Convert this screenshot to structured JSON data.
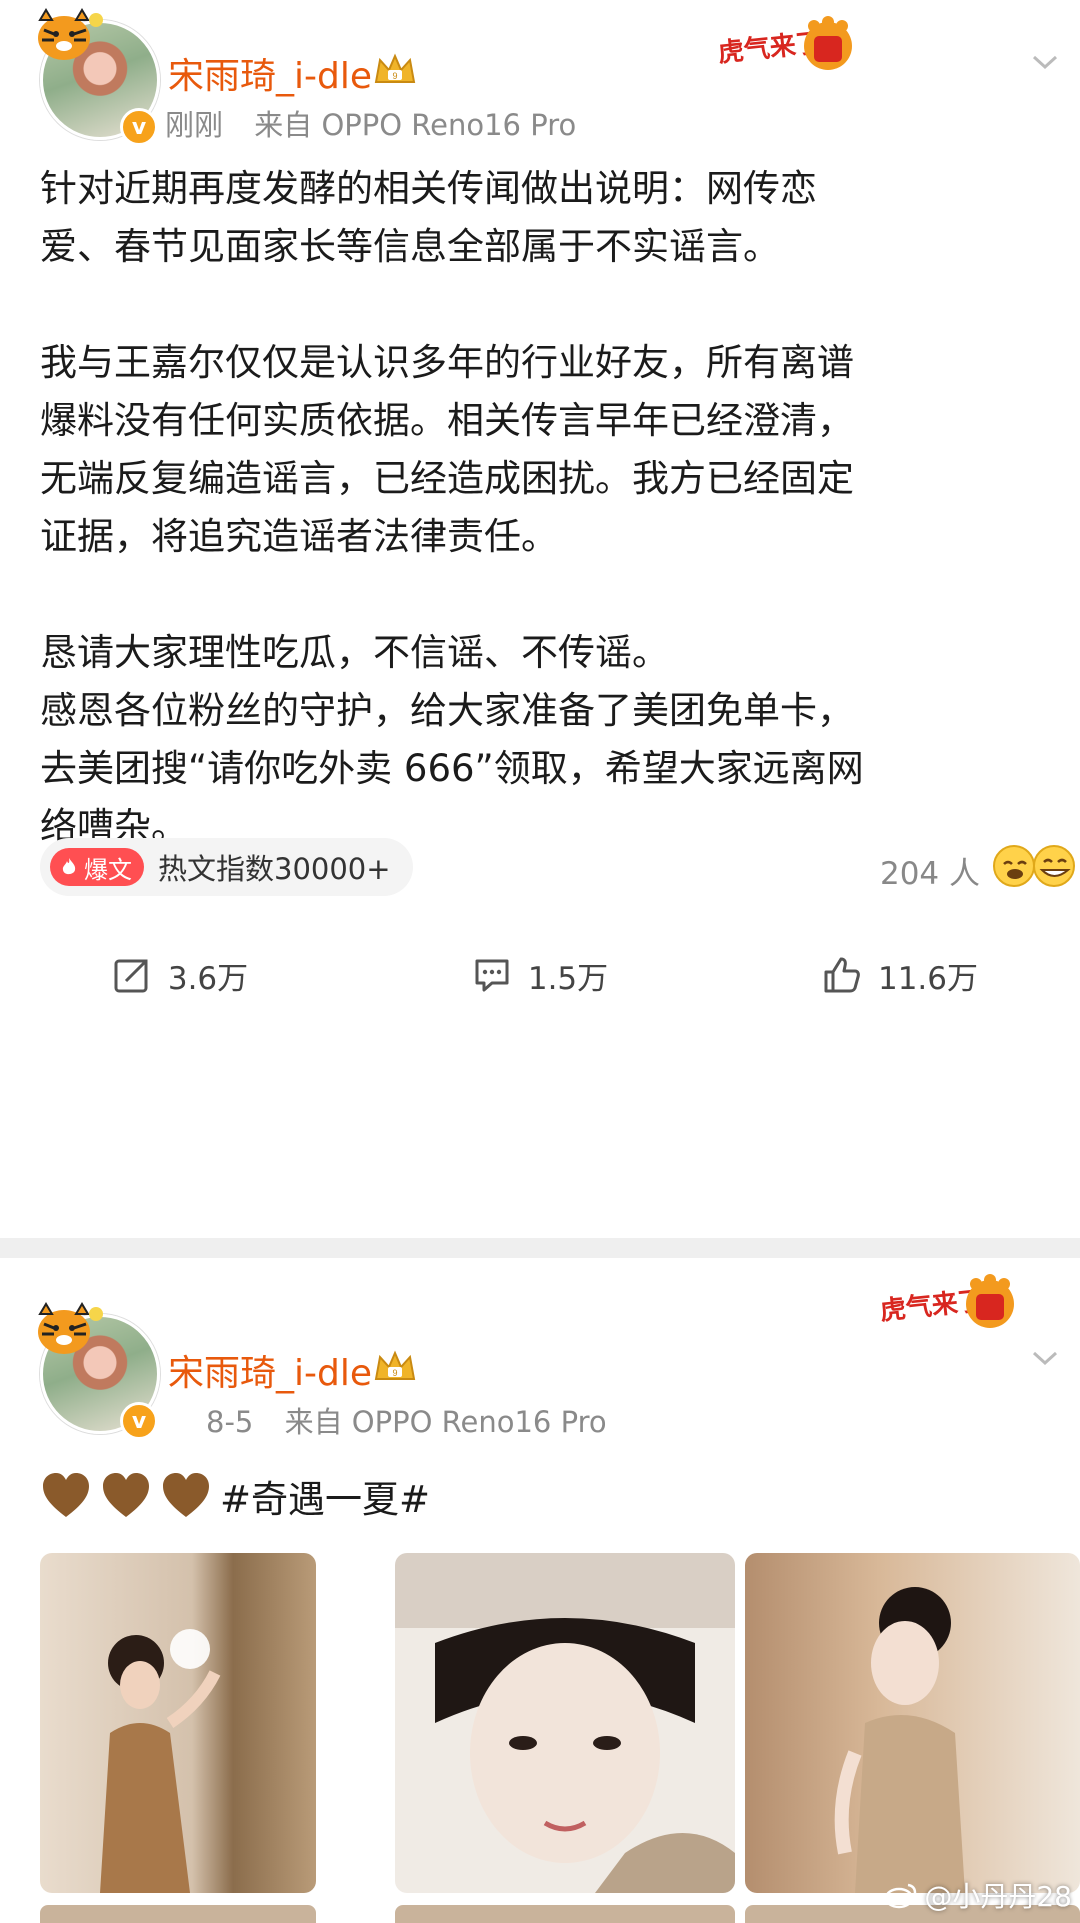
{
  "posts": [
    {
      "user": {
        "name": "宋雨琦_i-dle"
      },
      "meta": {
        "time": "刚刚",
        "source": "来自 OPPO Reno16 Pro"
      },
      "festive_badge": "虎气来了",
      "paragraphs": [
        "针对近期再度发酵的相关传闻做出说明：网传恋",
        "爱、春节见面家长等信息全部属于不实谣言。",
        "",
        "我与王嘉尔仅仅是认识多年的行业好友，所有离谱",
        "爆料没有任何实质依据。相关传言早年已经澄清，",
        "无端反复编造谣言，已经造成困扰。我方已经固定",
        "证据，将追究造谣者法律责任。",
        "",
        "恳请大家理性吃瓜，不信谣、不传谣。",
        "感恩各位粉丝的守护，给大家准备了美团免单卡，",
        "去美团搜“请你吃外卖 666”领取，希望大家远离网",
        "络嘈杂。"
      ],
      "hot": {
        "tag": "爆文",
        "text": "热文指数30000+"
      },
      "reactions_count": "204 人",
      "actions": {
        "repost": "3.6万",
        "comment": "1.5万",
        "like": "11.6万"
      }
    },
    {
      "user": {
        "name": "宋雨琦_i-dle"
      },
      "meta": {
        "time": "8-5",
        "source": "来自 OPPO Reno16 Pro"
      },
      "festive_badge": "虎气来了",
      "hashtag": "#奇遇一夏#",
      "heart_count": 3
    }
  ],
  "watermark": "@小丹丹28",
  "colors": {
    "username": "#e8590c",
    "hot": "#ff4f52",
    "heart": "#8a5a2b"
  }
}
